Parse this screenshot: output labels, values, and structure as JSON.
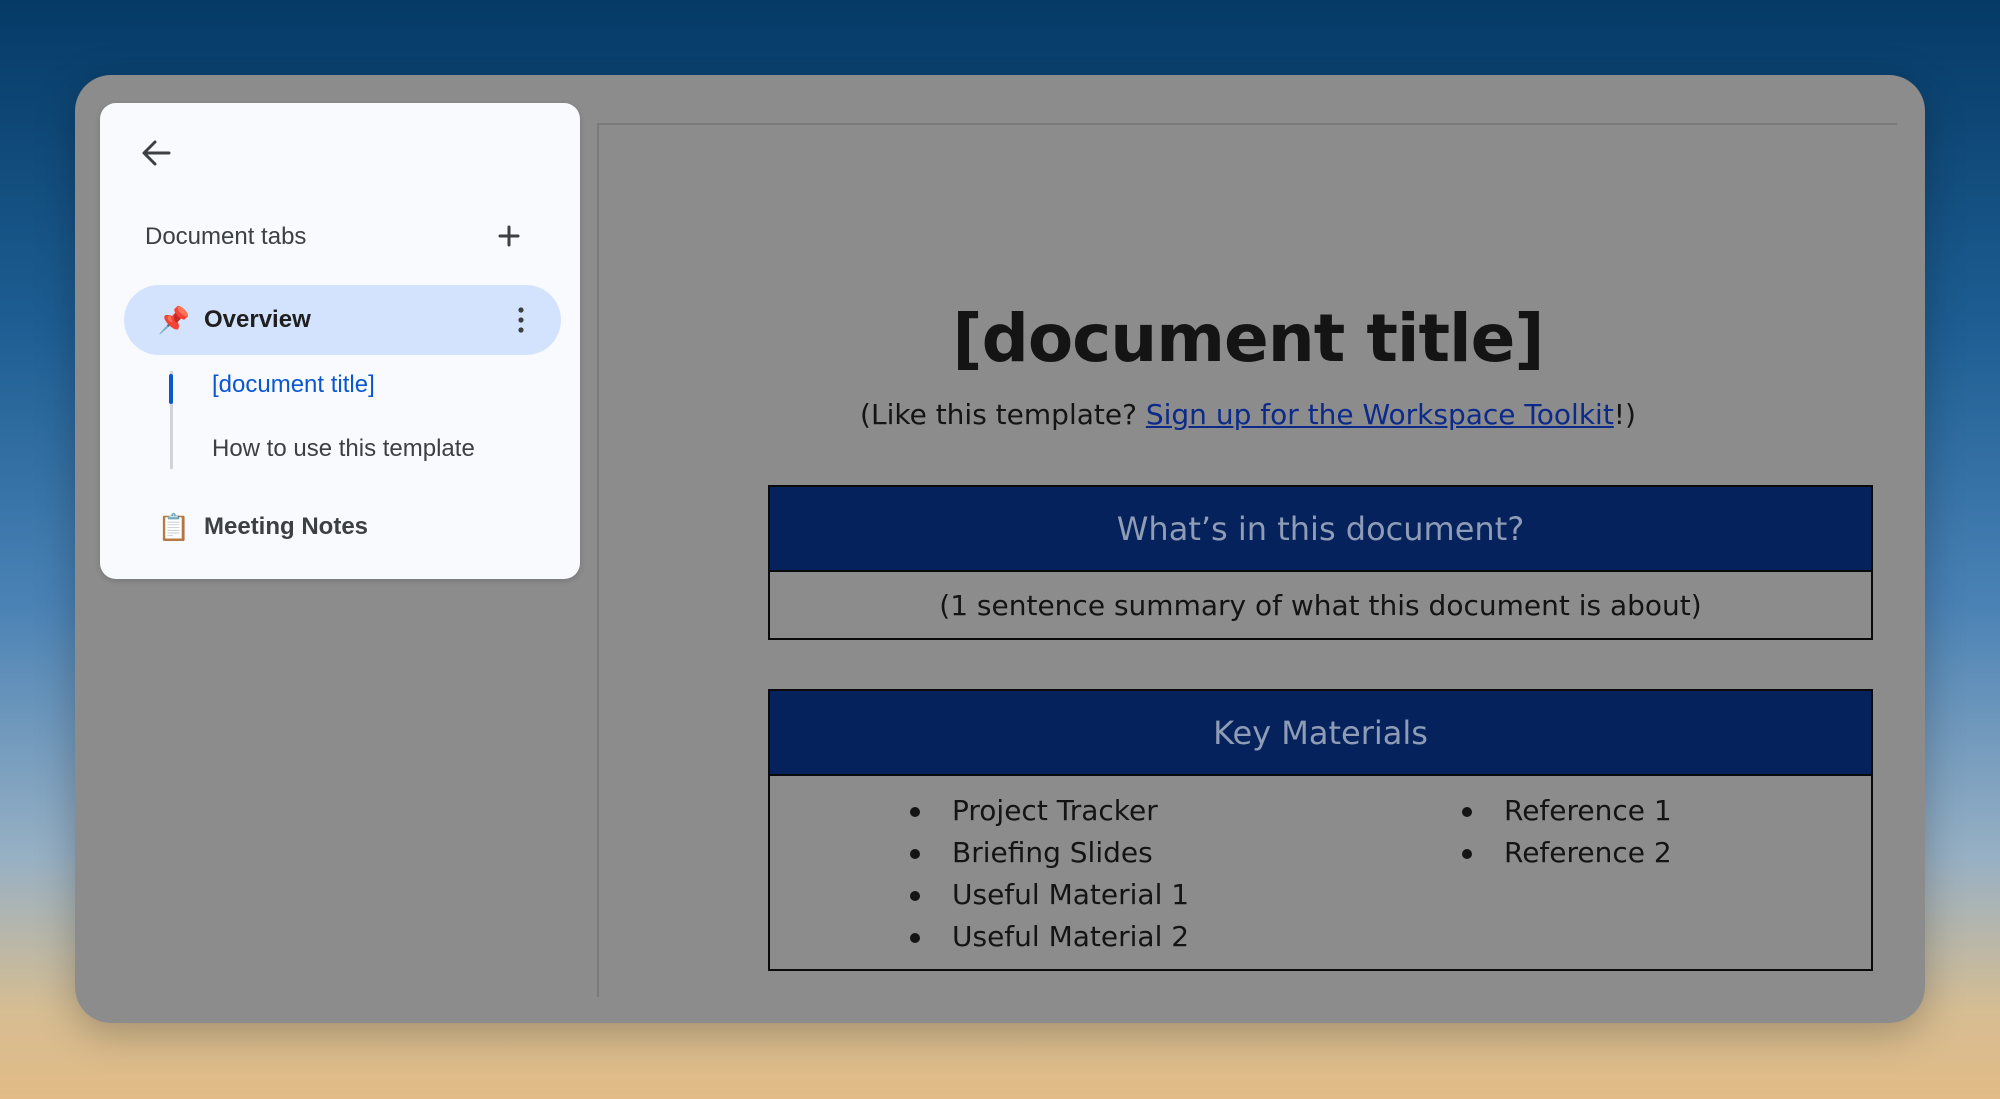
{
  "sidebar": {
    "heading": "Document tabs",
    "tabs": [
      {
        "emoji": "📌",
        "label": "Overview",
        "active": true
      },
      {
        "emoji": "📋",
        "label": "Meeting Notes",
        "active": false
      }
    ],
    "outline": [
      {
        "label": "[document title]",
        "active": true
      },
      {
        "label": "How to use this template",
        "active": false
      }
    ],
    "icons": {
      "back": "arrow-left-icon",
      "add": "plus-icon",
      "more": "more-vert-icon"
    }
  },
  "document": {
    "title": "[document title]",
    "subtitle": {
      "prefix": "(Like this template? ",
      "link": "Sign up for the Workspace Toolkit",
      "suffix": "!)"
    },
    "summary_box": {
      "heading": "What’s in this document?",
      "text": "(1 sentence summary of what this document is about)"
    },
    "materials_box": {
      "heading": "Key Materials",
      "left_items": [
        "Project Tracker",
        "Briefing Slides",
        "Useful Material 1",
        "Useful Material 2"
      ],
      "right_items": [
        "Reference 1",
        "Reference 2"
      ]
    }
  },
  "colors": {
    "accent_blue": "#0b57d0",
    "active_tab_bg": "#d3e3fd",
    "box_header_bg": "#06225c"
  }
}
